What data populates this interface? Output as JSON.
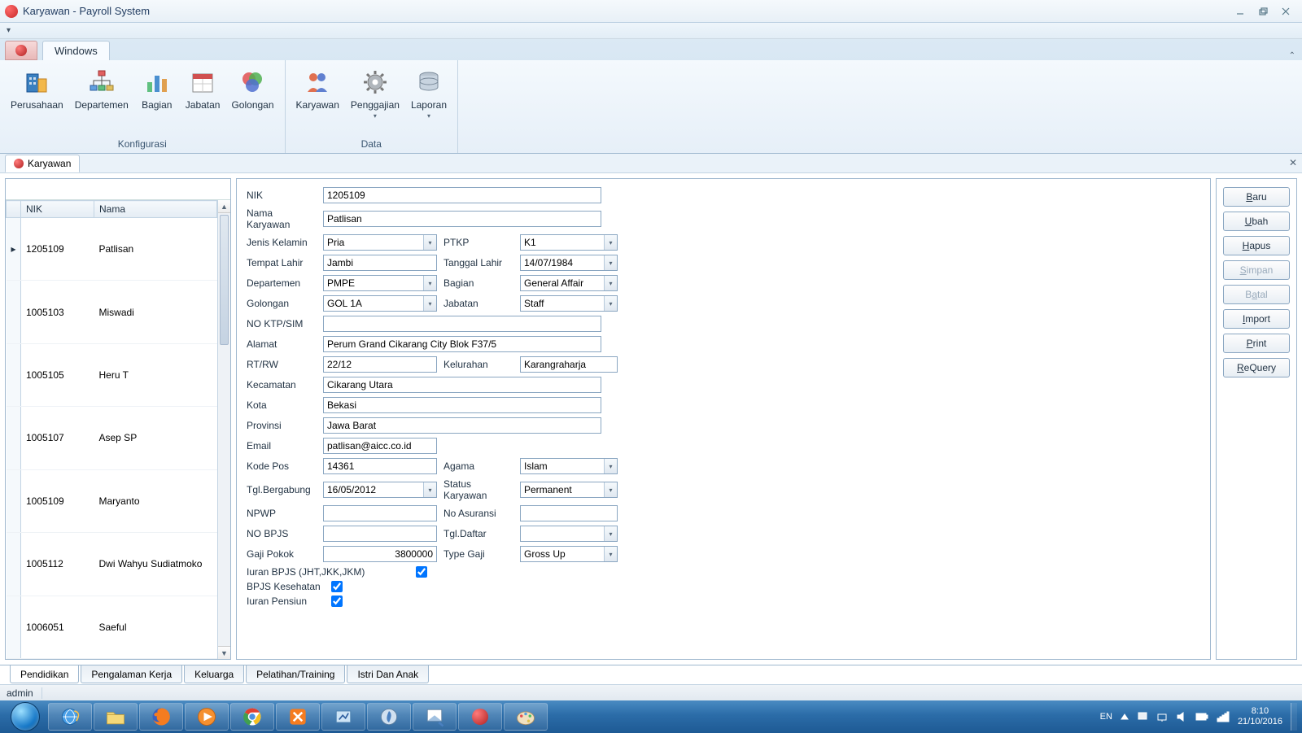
{
  "window": {
    "title": "Karyawan - Payroll System"
  },
  "ribbon": {
    "tab": "Windows",
    "groups": {
      "konfigurasi": {
        "label": "Konfigurasi",
        "items": [
          "Perusahaan",
          "Departemen",
          "Bagian",
          "Jabatan",
          "Golongan"
        ]
      },
      "data": {
        "label": "Data",
        "items": [
          "Karyawan",
          "Penggajian",
          "Laporan"
        ]
      }
    }
  },
  "doc_tab": "Karyawan",
  "grid": {
    "cols": [
      "NIK",
      "Nama"
    ],
    "rows": [
      {
        "nik": "1205109",
        "nama": "Patlisan"
      },
      {
        "nik": "1005103",
        "nama": "Miswadi"
      },
      {
        "nik": "1005105",
        "nama": "Heru T"
      },
      {
        "nik": "1005107",
        "nama": "Asep SP"
      },
      {
        "nik": "1005109",
        "nama": "Maryanto"
      },
      {
        "nik": "1005112",
        "nama": "Dwi Wahyu Sudiatmoko"
      },
      {
        "nik": "1006051",
        "nama": "Saeful"
      }
    ]
  },
  "form": {
    "nik_l": "NIK",
    "nik": "1205109",
    "nama_l": "Nama Karyawan",
    "nama": "Patlisan",
    "jk_l": "Jenis Kelamin",
    "jk": "Pria",
    "ptkp_l": "PTKP",
    "ptkp": "K1",
    "tmp_l": "Tempat Lahir",
    "tmp": "Jambi",
    "tgl_l": "Tanggal Lahir",
    "tgl": "14/07/1984",
    "dep_l": "Departemen",
    "dep": "PMPE",
    "bag_l": "Bagian",
    "bag": "General Affair",
    "gol_l": "Golongan",
    "gol": "GOL 1A",
    "jab_l": "Jabatan",
    "jab": "Staff",
    "ktp_l": "NO KTP/SIM",
    "ktp": "",
    "alm_l": "Alamat",
    "alm": "Perum Grand Cikarang City Blok F37/5",
    "rtrw_l": "RT/RW",
    "rtrw": "22/12",
    "kel_l": "Kelurahan",
    "kel": "Karangraharja",
    "kec_l": "Kecamatan",
    "kec": "Cikarang Utara",
    "kota_l": "Kota",
    "kota": "Bekasi",
    "prov_l": "Provinsi",
    "prov": "Jawa Barat",
    "email_l": "Email",
    "email": "patlisan@aicc.co.id",
    "kpos_l": "Kode Pos",
    "kpos": "14361",
    "agama_l": "Agama",
    "agama": "Islam",
    "tglb_l": "Tgl.Bergabung",
    "tglb": "16/05/2012",
    "stat_l": "Status Karyawan",
    "stat": "Permanent",
    "npwp_l": "NPWP",
    "npwp": "",
    "asr_l": "No Asuransi",
    "asr": "",
    "bpjs_l": "NO BPJS",
    "bpjs": "",
    "tgld_l": "Tgl.Daftar",
    "tgld": "",
    "gaji_l": "Gaji Pokok",
    "gaji": "3800000",
    "tgaji_l": "Type Gaji",
    "tgaji": "Gross Up",
    "iuran_l": "Iuran BPJS (JHT,JKK,JKM)",
    "kes_l": "BPJS Kesehatan",
    "pensiun_l": "Iuran Pensiun"
  },
  "buttons": {
    "baru": "Baru",
    "ubah": "Ubah",
    "hapus": "Hapus",
    "simpan": "Simpan",
    "batal": "Batal",
    "import": "Import",
    "print": "Print",
    "requery": "ReQuery"
  },
  "bottom_tabs": [
    "Pendidikan",
    "Pengalaman Kerja",
    "Keluarga",
    "Pelatihan/Training",
    "Istri Dan Anak"
  ],
  "status": {
    "user": "admin"
  },
  "taskbar": {
    "lang": "EN",
    "time": "8:10",
    "date": "21/10/2016"
  }
}
